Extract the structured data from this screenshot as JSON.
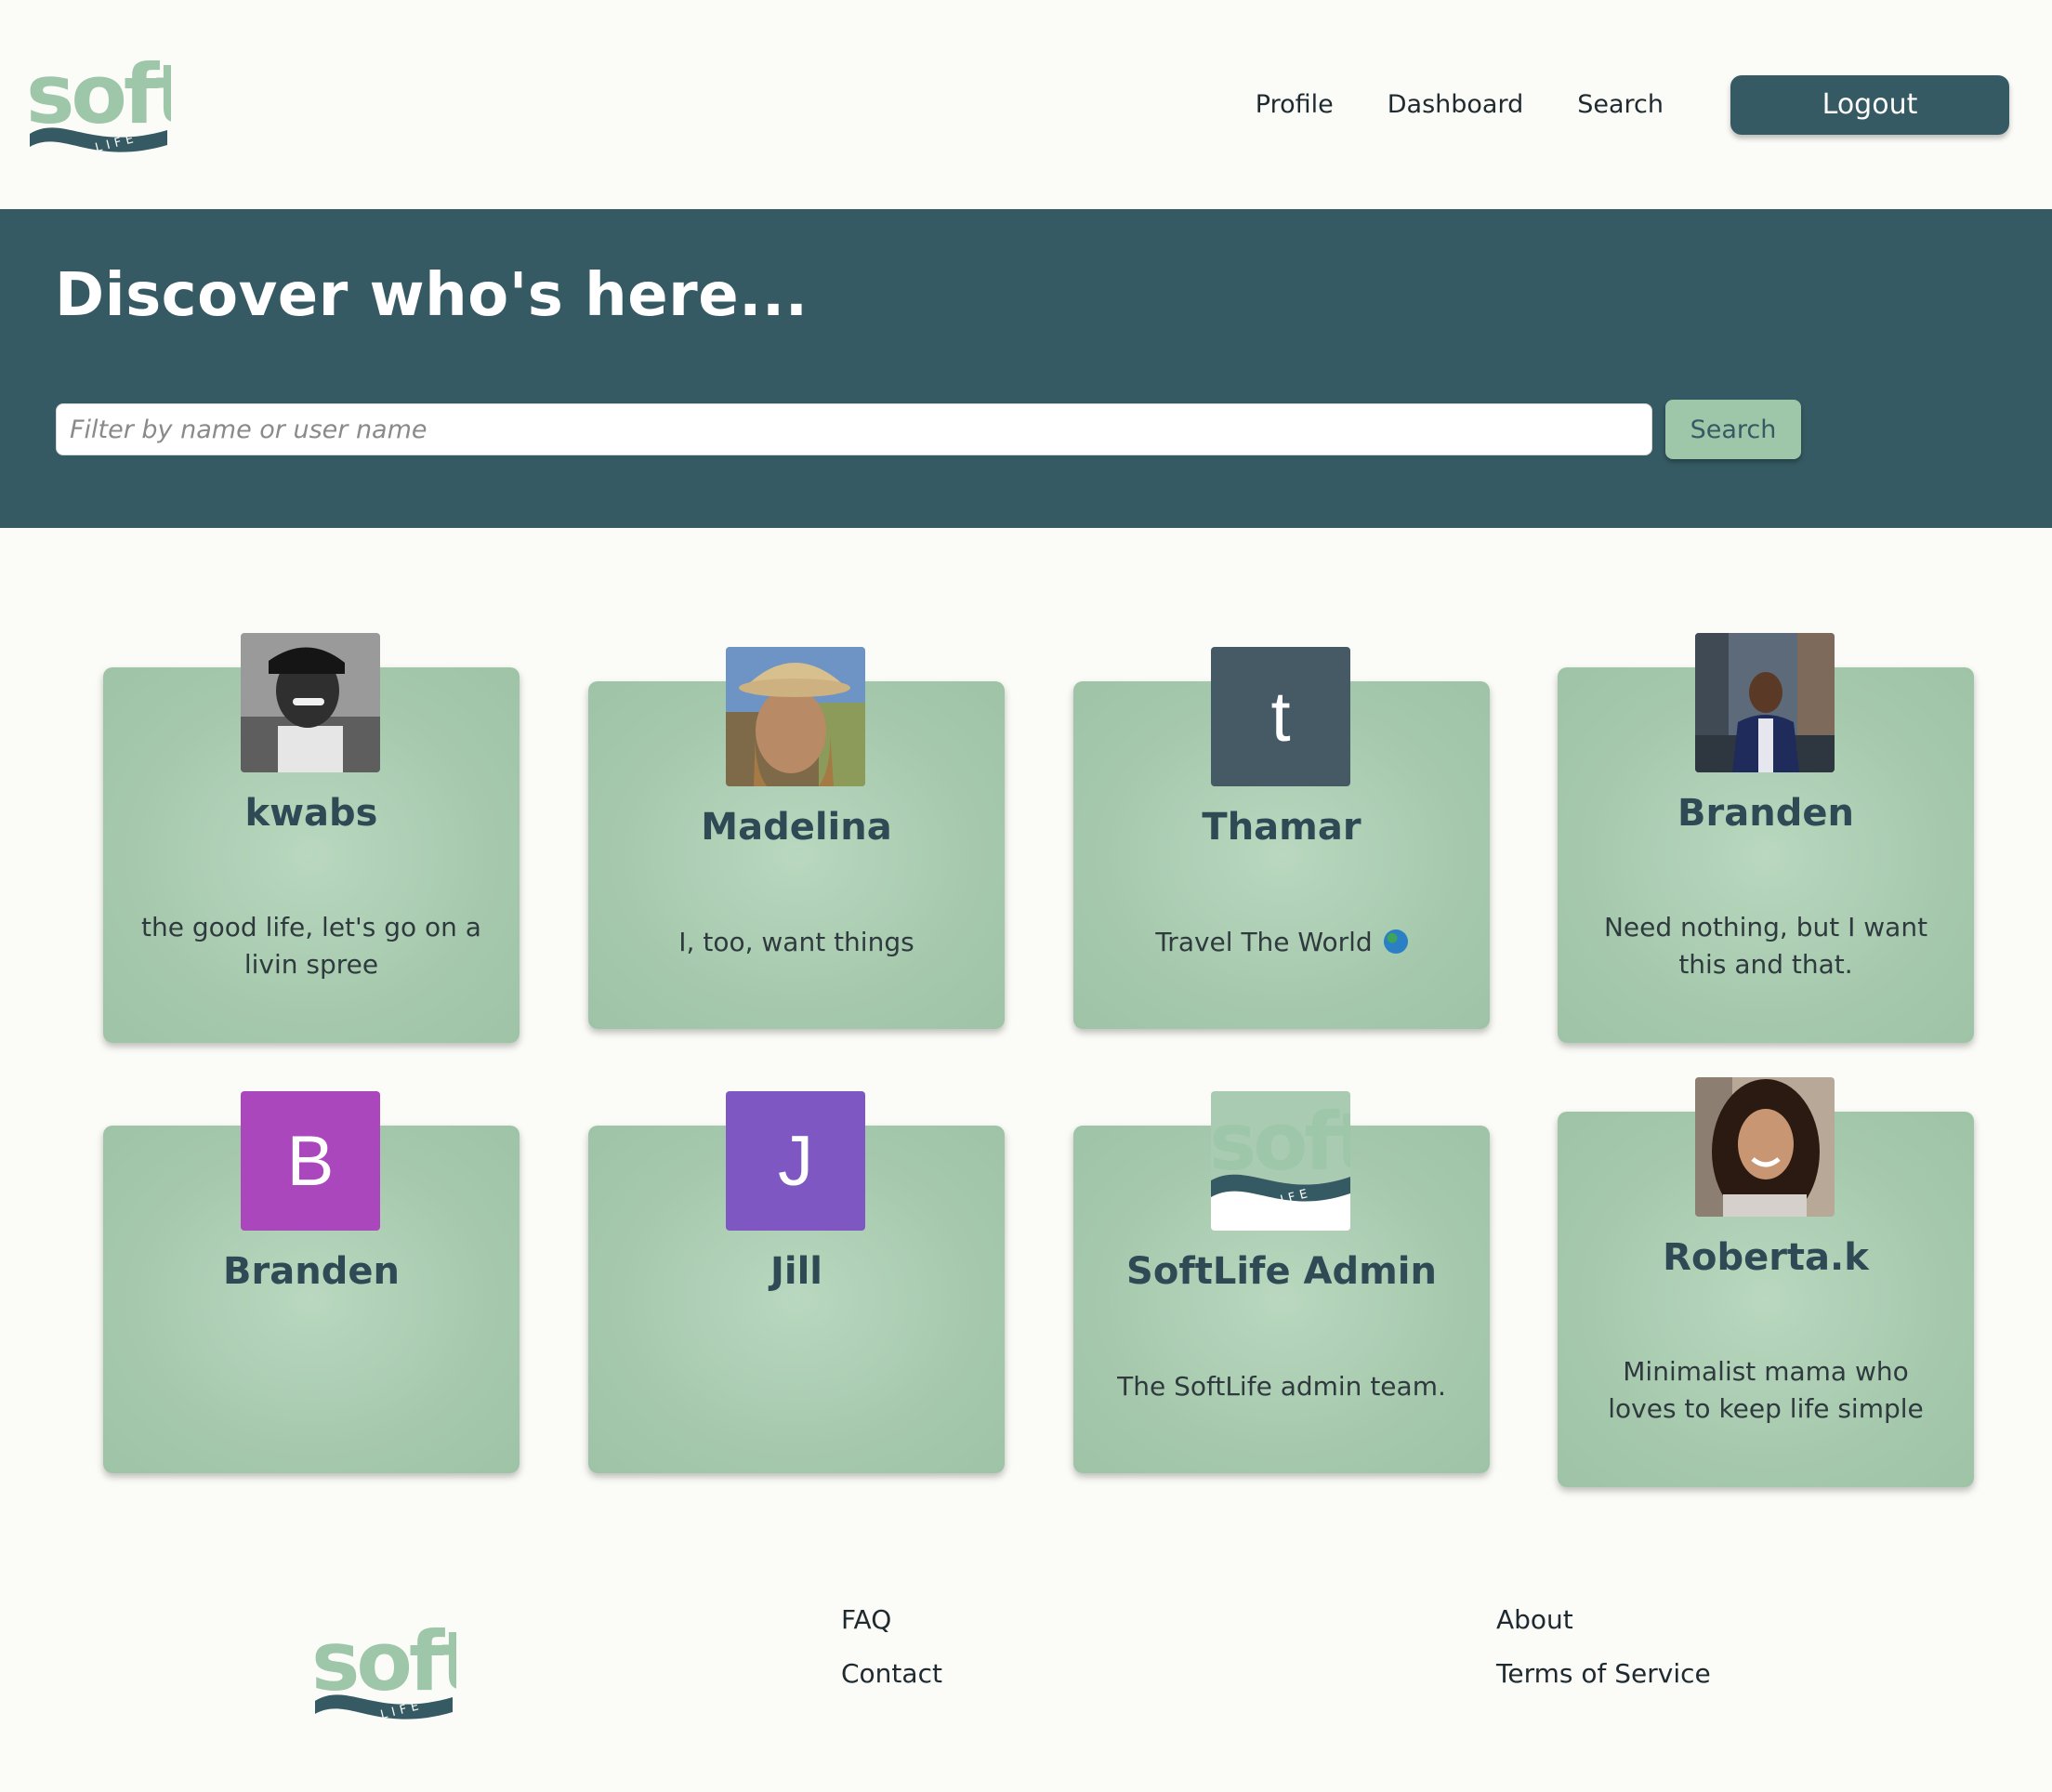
{
  "header": {
    "logo": {
      "word": "soft",
      "sub": "LIFE"
    },
    "nav": [
      "Profile",
      "Dashboard",
      "Search"
    ],
    "logout_label": "Logout"
  },
  "hero": {
    "title": "Discover who's here...",
    "search_placeholder": "Filter by name or user name",
    "search_button": "Search"
  },
  "cards": [
    {
      "name": "kwabs",
      "bio": "the good life, let's go on a livin spree",
      "avatar": "photo"
    },
    {
      "name": "Madelina",
      "bio": "I, too, want things",
      "avatar": "photo"
    },
    {
      "name": "Thamar",
      "bio": "Travel The World",
      "bio_emoji": "globe-icon",
      "avatar": "letter",
      "letter": "t",
      "color": "#455a64"
    },
    {
      "name": "Branden",
      "bio": "Need nothing, but I want this and that.",
      "avatar": "photo"
    },
    {
      "name": "Branden",
      "bio": "",
      "avatar": "letter",
      "letter": "B",
      "color": "#ab47bc"
    },
    {
      "name": "Jill",
      "bio": "",
      "avatar": "letter",
      "letter": "J",
      "color": "#7e57c2"
    },
    {
      "name": "SoftLife Admin",
      "bio": "The SoftLife admin team.",
      "avatar": "logo"
    },
    {
      "name": "Roberta.k",
      "bio": "Minimalist mama who loves to keep life simple",
      "avatar": "photo"
    }
  ],
  "footer": {
    "links": [
      "FAQ",
      "Contact",
      "About",
      "Terms of Service"
    ]
  },
  "colors": {
    "primary": "#355a63",
    "accent": "#9ec6a8",
    "background": "#fbfbf7"
  }
}
